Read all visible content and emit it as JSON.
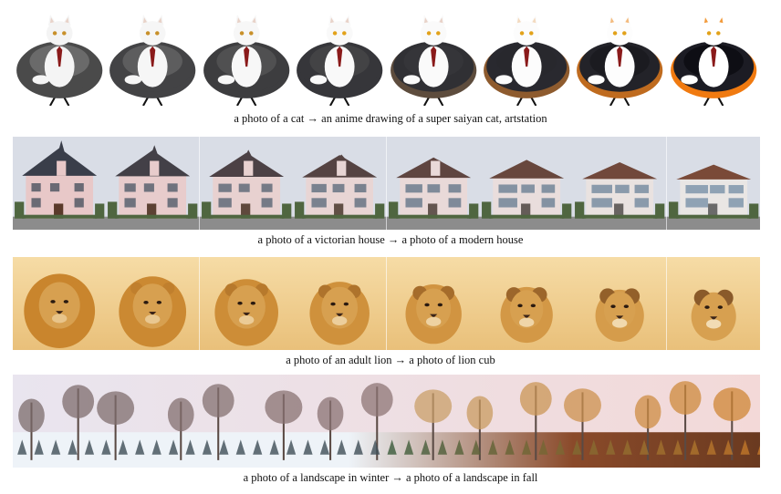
{
  "rows": [
    {
      "id": "cat",
      "caption": "a photo of a cat → an anime drawing of a super saiyan cat, artstation",
      "frames": 8,
      "colors": {
        "bg": "#ffffff",
        "chair_start": "#4a4a4a",
        "chair_end": "#1c1c24",
        "accent_end": "#f07a10",
        "fur": "#f4f4f4",
        "tie": "#8a1a1a"
      }
    },
    {
      "id": "house",
      "caption": "a photo of a victorian house → a photo of a modern house",
      "frames": 8,
      "colors": {
        "sky": "#d9dde6",
        "victorian_wall": "#e8c8c8",
        "victorian_roof": "#3a3e4a",
        "modern_wall": "#e9e6e4",
        "modern_roof": "#7a4a38",
        "ground": "#8c8c8c",
        "tree": "#4f6640"
      }
    },
    {
      "id": "lion",
      "caption": "a photo of an adult lion → a photo of lion cub",
      "frames": 8,
      "colors": {
        "bg": "#e9c07a",
        "bg_light": "#f6dca6",
        "mane": "#c9852d",
        "face": "#d7a050",
        "nose": "#3b2418"
      }
    },
    {
      "id": "landscape",
      "caption": "a photo of a landscape in winter → a photo of a landscape in fall",
      "colors": {
        "sky_left": "#e9e5ef",
        "sky_right": "#f3d9d8",
        "snow": "#eef3f8",
        "fall_ground": "#8a4a2a",
        "trees": "#5a4a44",
        "foliage": "#d0822f"
      }
    }
  ]
}
